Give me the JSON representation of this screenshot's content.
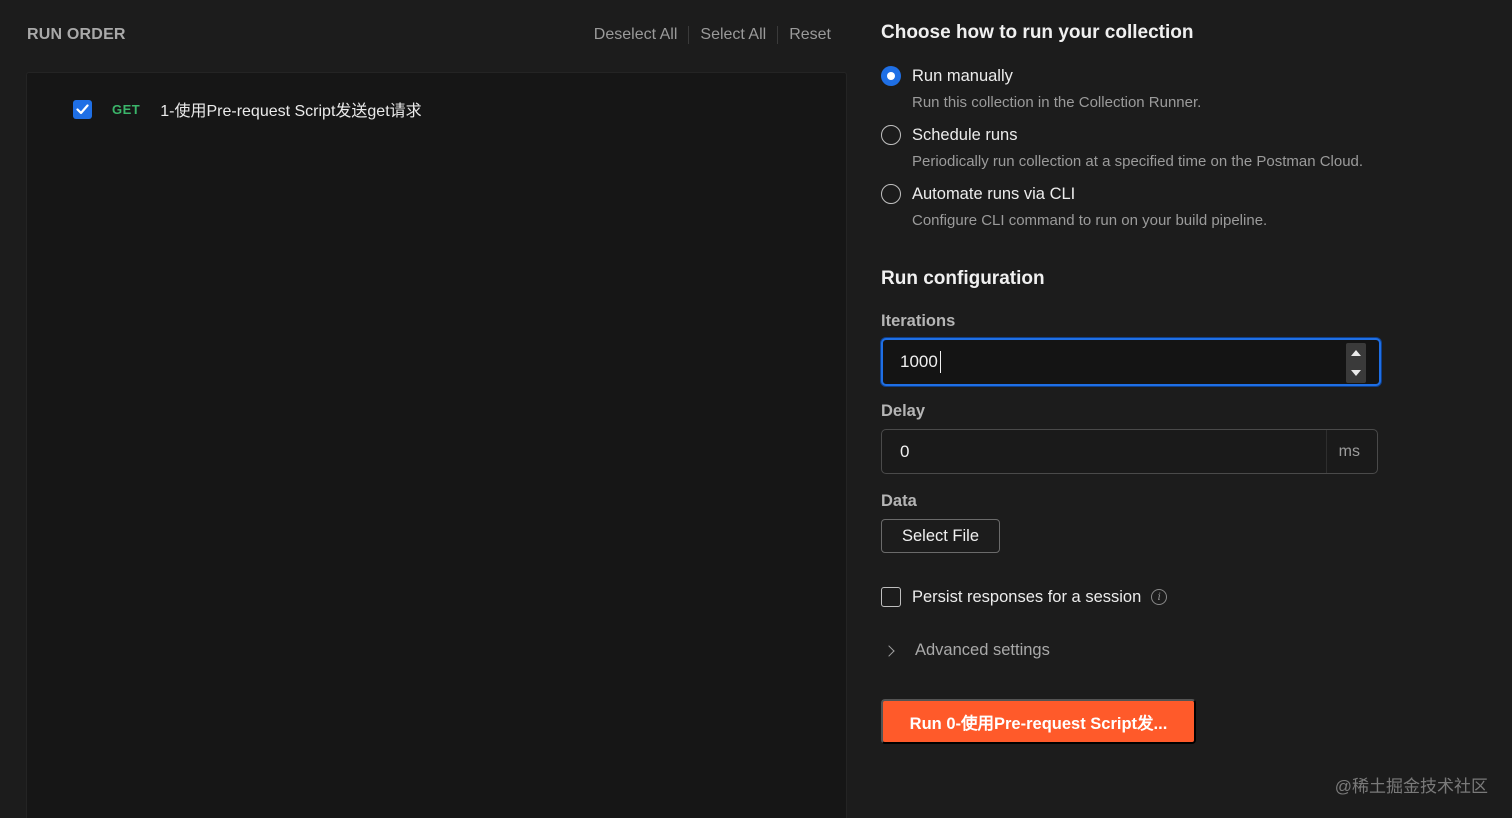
{
  "run_order": {
    "title": "RUN ORDER",
    "actions": {
      "deselect_all": "Deselect All",
      "select_all": "Select All",
      "reset": "Reset"
    },
    "requests": [
      {
        "method": "GET",
        "name": "1-使用Pre-request Script发送get请求",
        "checked": true
      }
    ]
  },
  "run_mode": {
    "title": "Choose how to run your collection",
    "options": [
      {
        "label": "Run manually",
        "description": "Run this collection in the Collection Runner.",
        "selected": true
      },
      {
        "label": "Schedule runs",
        "description": "Periodically run collection at a specified time on the Postman Cloud.",
        "selected": false
      },
      {
        "label": "Automate runs via CLI",
        "description": "Configure CLI command to run on your build pipeline.",
        "selected": false
      }
    ]
  },
  "run_config": {
    "title": "Run configuration",
    "iterations_label": "Iterations",
    "iterations_value": "1000",
    "delay_label": "Delay",
    "delay_value": "0",
    "delay_unit": "ms",
    "data_label": "Data",
    "select_file": "Select File",
    "persist_label": "Persist responses for a session",
    "advanced_label": "Advanced settings",
    "run_button": "Run 0-使用Pre-request Script发..."
  },
  "watermark": "@稀土掘金技术社区",
  "colors": {
    "accent_blue": "#1f6fe5",
    "run_orange": "#ff5a2a",
    "method_get_green": "#3bb56a"
  }
}
